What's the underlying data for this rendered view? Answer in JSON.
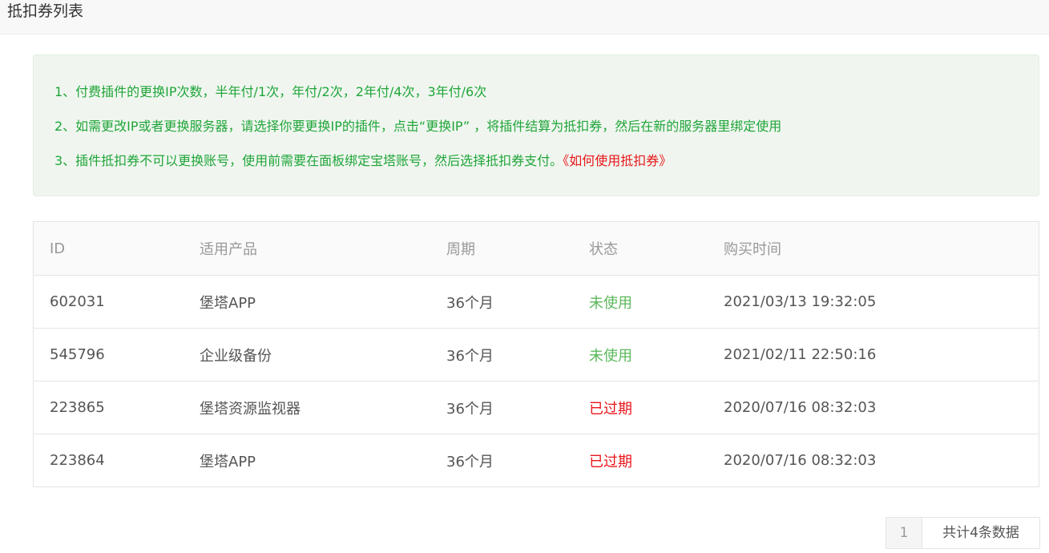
{
  "header": {
    "title": "抵扣券列表"
  },
  "notice": {
    "line1": "1、付费插件的更换IP次数，半年付/1次，年付/2次，2年付/4次，3年付/6次",
    "line2": "2、如需更改IP或者更换服务器，请选择你要更换IP的插件，点击“更换IP” ，将插件结算为抵扣券，然后在新的服务器里绑定使用",
    "line3": "3、插件抵扣券不可以更换账号，使用前需要在面板绑定宝塔账号，然后选择抵扣券支付。",
    "link": "《如何使用抵扣券》"
  },
  "table": {
    "headers": [
      "ID",
      "适用产品",
      "周期",
      "状态",
      "购买时间"
    ],
    "rows": [
      {
        "id": "602031",
        "product": "堡塔APP",
        "period": "36个月",
        "status": "未使用",
        "time": "2021/03/13 19:32:05"
      },
      {
        "id": "545796",
        "product": "企业级备份",
        "period": "36个月",
        "status": "未使用",
        "time": "2021/02/11 22:50:16"
      },
      {
        "id": "223865",
        "product": "堡塔资源监视器",
        "period": "36个月",
        "status": "已过期",
        "time": "2020/07/16 08:32:03"
      },
      {
        "id": "223864",
        "product": "堡塔APP",
        "period": "36个月",
        "status": "已过期",
        "time": "2020/07/16 08:32:03"
      }
    ]
  },
  "pager": {
    "page": "1",
    "total": "共计4条数据"
  },
  "colors": {
    "accent_green": "#20a53a",
    "unused": "#5cb85c",
    "expired": "#e8161b"
  }
}
